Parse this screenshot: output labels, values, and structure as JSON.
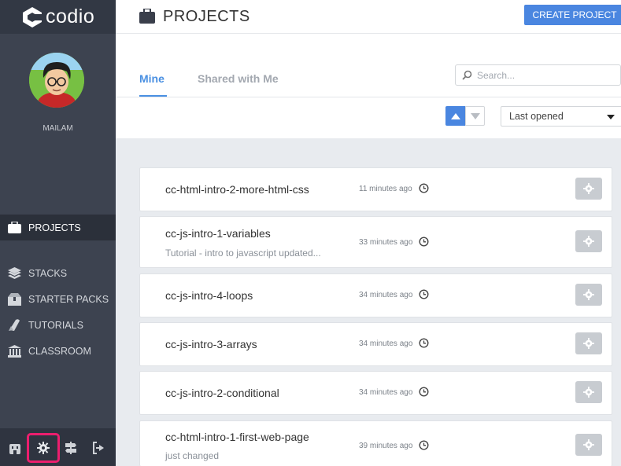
{
  "brand": {
    "name": "codio"
  },
  "user": {
    "name": "MAILAM"
  },
  "nav": [
    {
      "id": "projects",
      "label": "PROJECTS",
      "icon": "briefcase-icon",
      "active": true
    },
    {
      "id": "stacks",
      "label": "STACKS",
      "icon": "layers-icon",
      "active": false
    },
    {
      "id": "starter-packs",
      "label": "STARTER PACKS",
      "icon": "box-icon",
      "active": false
    },
    {
      "id": "tutorials",
      "label": "TUTORIALS",
      "icon": "book-icon",
      "active": false
    },
    {
      "id": "classroom",
      "label": "CLASSROOM",
      "icon": "building-icon",
      "active": false
    }
  ],
  "bottom_bar": [
    {
      "id": "dashboard",
      "icon": "dashboard-icon"
    },
    {
      "id": "settings",
      "icon": "gear-icon",
      "highlighted": true
    },
    {
      "id": "signpost",
      "icon": "signpost-icon"
    },
    {
      "id": "logout",
      "icon": "logout-icon"
    }
  ],
  "header": {
    "title": "PROJECTS",
    "create_button": "CREATE PROJECT"
  },
  "tabs": [
    {
      "label": "Mine",
      "active": true
    },
    {
      "label": "Shared with Me",
      "active": false
    }
  ],
  "search": {
    "placeholder": "Search...",
    "value": ""
  },
  "sort": {
    "selected": "Last opened",
    "direction": "ascending"
  },
  "projects": [
    {
      "name": "cc-html-intro-2-more-html-css",
      "description": "",
      "time": "11 minutes ago"
    },
    {
      "name": "cc-js-intro-1-variables",
      "description": "Tutorial - intro to javascript updated...",
      "time": "33 minutes ago"
    },
    {
      "name": "cc-js-intro-4-loops",
      "description": "",
      "time": "34 minutes ago"
    },
    {
      "name": "cc-js-intro-3-arrays",
      "description": "",
      "time": "34 minutes ago"
    },
    {
      "name": "cc-js-intro-2-conditional",
      "description": "",
      "time": "34 minutes ago"
    },
    {
      "name": "cc-html-intro-1-first-web-page",
      "description": "just changed",
      "time": "39 minutes ago"
    }
  ],
  "colors": {
    "sidebar": "#3d4350",
    "accent": "#4a86e0",
    "highlight": "#ec1e6e"
  }
}
